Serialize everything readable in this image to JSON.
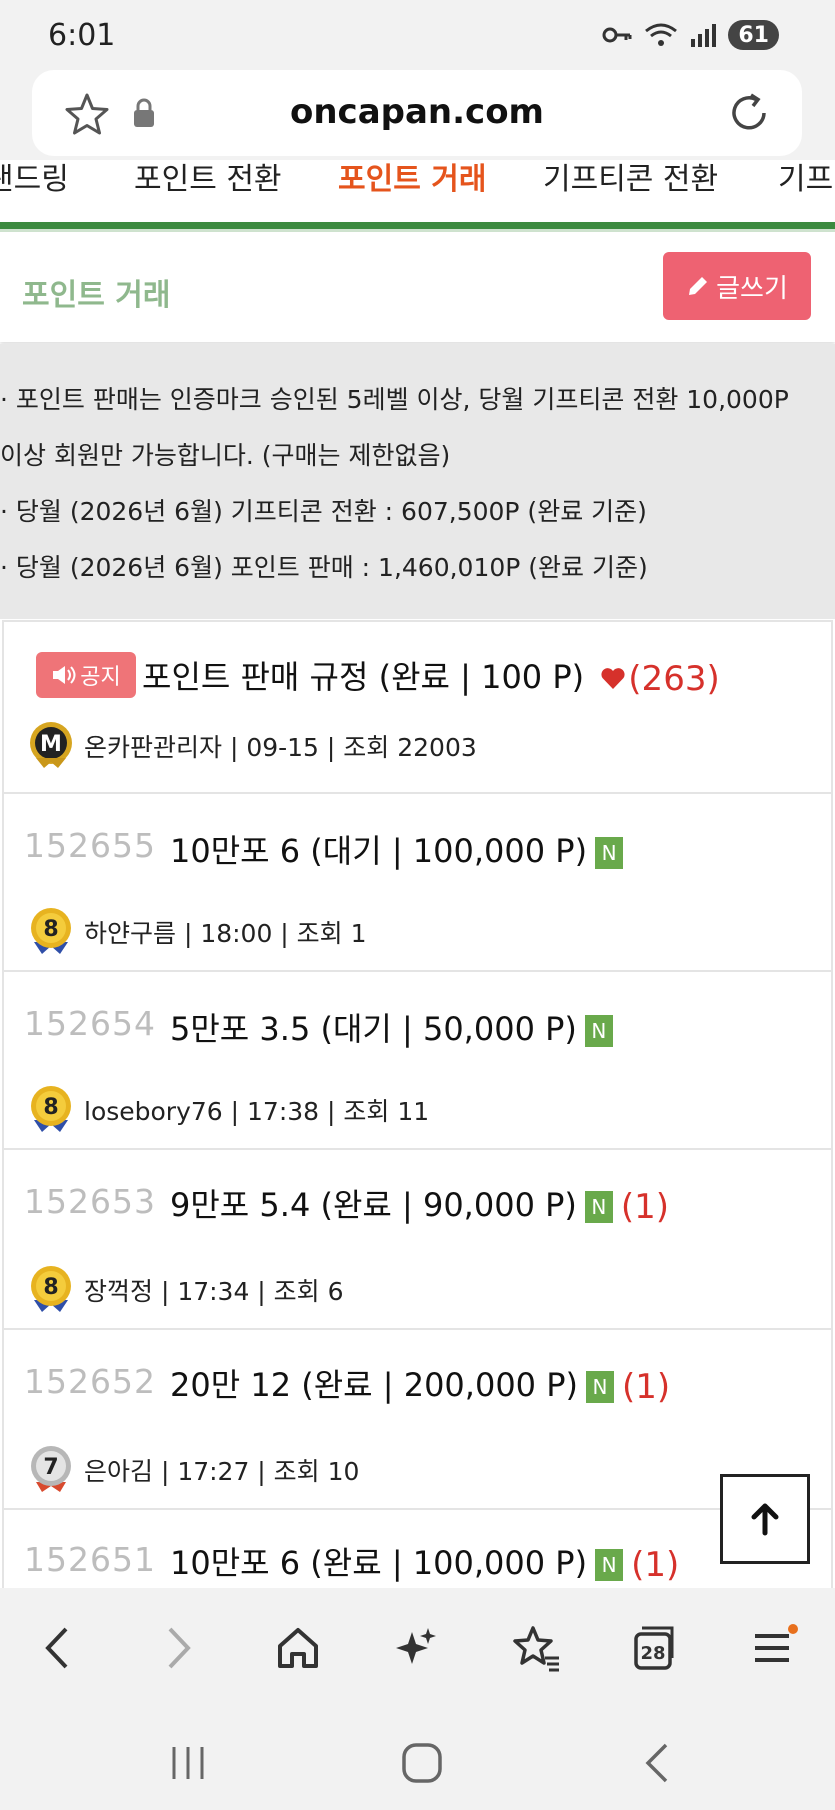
{
  "status": {
    "time": "6:01",
    "battery": "61"
  },
  "browser": {
    "url": "oncapan.com",
    "tab_count": "28"
  },
  "tabs": [
    {
      "label": "랜드링"
    },
    {
      "label": "포인트 전환"
    },
    {
      "label": "포인트 거래"
    },
    {
      "label": "기프티콘 전환"
    },
    {
      "label": "기프"
    }
  ],
  "board": {
    "title": "포인트 거래",
    "write_label": "글쓰기"
  },
  "info": {
    "line1": "· 포인트 판매는 인증마크 승인된 5레벨 이상, 당월 기프티콘 전환 10,000P",
    "line2": "이상 회원만 가능합니다. (구매는 제한없음)",
    "line3": "· 당월 (2026년 6월) 기프티콘 전환 : 607,500P (완료 기준)",
    "line4": "· 당월 (2026년 6월) 포인트 판매 : 1,460,010P (완료 기준)"
  },
  "notice": {
    "badge": "공지",
    "subject": "포인트 판매 규정 (완료 | 100 P)",
    "comments": "(263)",
    "level": "M",
    "meta": "온카판관리자 | 09-15 | 조회 22003"
  },
  "posts": [
    {
      "num": "152655",
      "subject": "10만포 6 (대기 | 100,000 P)",
      "new": "N",
      "comments": "",
      "level": "8",
      "meta": "하얀구름 | 18:00 | 조회 1"
    },
    {
      "num": "152654",
      "subject": "5만포 3.5 (대기 | 50,000 P)",
      "new": "N",
      "comments": "",
      "level": "8",
      "meta": "losebory76 | 17:38 | 조회 11"
    },
    {
      "num": "152653",
      "subject": "9만포 5.4 (완료 | 90,000 P)",
      "new": "N",
      "comments": "(1)",
      "level": "8",
      "meta": "장꺽정 | 17:34 | 조회 6"
    },
    {
      "num": "152652",
      "subject": "20만 12 (완료 | 200,000 P)",
      "new": "N",
      "comments": "(1)",
      "level": "7",
      "meta": "은아김 | 17:27 | 조회 10"
    },
    {
      "num": "152651",
      "subject": "10만포 6 (완료 | 100,000 P)",
      "new": "N",
      "comments": "(1)",
      "level": "",
      "meta": ""
    }
  ],
  "colors": {
    "accent_tab": "#e5541c",
    "green": "#3c8a3f",
    "write_button": "#ee6272",
    "comment": "#d6312b"
  }
}
